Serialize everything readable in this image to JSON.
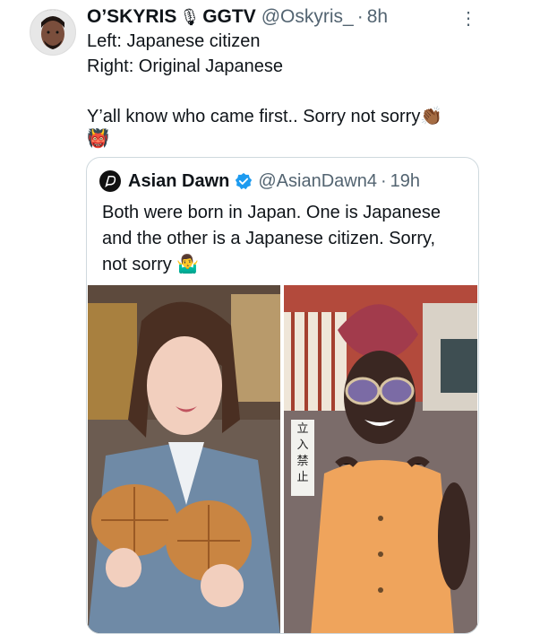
{
  "post": {
    "author_name": "O’SKYRIS",
    "author_suffix": "GGTV",
    "handle": "@Oskyris_",
    "separator": "·",
    "time": "8h",
    "lines": [
      "Left: Japanese citizen",
      "Right: Original Japanese",
      "Y’all know who came first.. Sorry not sorry"
    ],
    "clap_emoji": "👏🏾",
    "extra_emoji": "👹"
  },
  "quote": {
    "author_name": "Asian Dawn",
    "handle": "@AsianDawn4",
    "separator": "·",
    "time": "19h",
    "lines": [
      "Both were born in Japan. One is Japanese",
      "and the other is a Japanese citizen. Sorry,",
      "not sorry"
    ],
    "emoji": "🤷‍♂️",
    "sign_text": "立入禁止"
  },
  "icons": {
    "more": "more-options-icon",
    "verified": "verified-badge-icon",
    "mic": "microphone-icon"
  },
  "colors": {
    "secondary_text": "#536471",
    "verified_blue": "#1d9bf0",
    "border": "#cfd9de"
  }
}
